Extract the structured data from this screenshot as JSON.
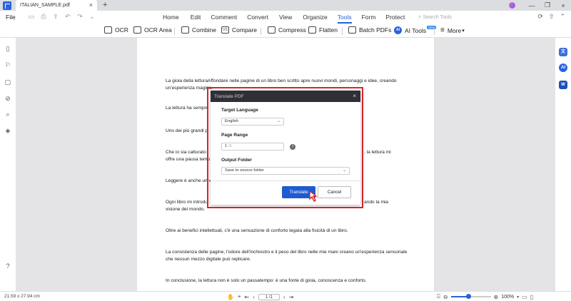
{
  "tabbar": {
    "doc_tab_title": "ITALIAN_SAMPLE.pdf",
    "close_glyph": "×",
    "new_tab_glyph": "+",
    "window_controls": [
      "—",
      "❐",
      "×"
    ]
  },
  "menubar": {
    "file_label": "File",
    "items": [
      "Home",
      "Edit",
      "Comment",
      "Convert",
      "View",
      "Organize",
      "Tools",
      "Form",
      "Protect"
    ],
    "active": "Tools",
    "search_placeholder": "Search Tools"
  },
  "toolbar": {
    "ocr": "OCR",
    "ocr_area": "OCR Area",
    "combine": "Combine",
    "compare": "Compare",
    "compress": "Compress",
    "flatten": "Flatten",
    "batch_pdfs": "Batch PDFs",
    "ai_tools": "AI Tools",
    "ai_badge": "AI",
    "new_badge": "NEW",
    "more": "More"
  },
  "document": {
    "paragraphs": [
      "La gioia della letturaAffondare nelle pagine di un libro ben scritto apre nuovi mondi, personaggi e idee, creando un'esperienza magica.",
      "La lettura ha sempre",
      "Uno dei più grandi p",
      "Che io sia catturato",
      "offre una pausa temp",
      ", la lettura mi",
      "Leggere è anche un v",
      "Ogni libro mi introdu",
      "visione del mondo.",
      "ando la mia",
      "Oltre ai benefici intellettuali, c'è una sensazione di conforto legata alla fisicità di un libro.",
      "La consistenza delle pagine, l'odore dell'inchiostro e il peso del libro nelle mie mani creano un'esperienza sensoriale che nessun mezzo digitale può replicare.",
      "In conclusione, la lettura non è solo un passatempo: è una fonte di gioia, conoscenza e conforto."
    ]
  },
  "dialog": {
    "title": "Translate PDF",
    "close_glyph": "×",
    "target_language_label": "Target Language",
    "target_language_value": "English",
    "page_range_label": "Page Range",
    "page_range_value": "1",
    "page_range_total": "/1",
    "output_folder_label": "Output Folder",
    "output_folder_value": "Save to source folder",
    "translate_button": "Translate",
    "cancel_button": "Cancel",
    "info_glyph": "!"
  },
  "statusbar": {
    "page_size": "21.59 x 27.94 cm",
    "page_indicator": "1 /1",
    "zoom": "100%",
    "zoom_fraction": 0.45
  },
  "right_sidebar": {
    "translate_icon_label": "文",
    "ai_icon_label": "AI"
  },
  "colors": {
    "accent": "#2562d8",
    "highlight_border": "#d6262b",
    "dialog_header": "#2f3036"
  }
}
